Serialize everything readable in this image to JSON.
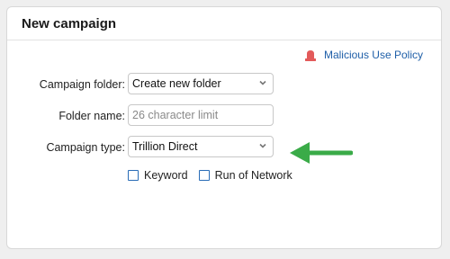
{
  "panel": {
    "title": "New campaign"
  },
  "policy": {
    "label": "Malicious Use Policy",
    "icon": "alarm-icon",
    "icon_color": "#e35a5a",
    "link_color": "#1f5fa8"
  },
  "fields": {
    "folder": {
      "label": "Campaign folder:",
      "value": "Create new folder"
    },
    "folder_name": {
      "label": "Folder name:",
      "placeholder": "26 character limit",
      "value": ""
    },
    "type": {
      "label": "Campaign type:",
      "value": "Trillion Direct"
    }
  },
  "checkboxes": [
    {
      "label": "Keyword",
      "checked": false
    },
    {
      "label": "Run of Network",
      "checked": false
    }
  ],
  "annotation": {
    "icon": "green-arrow-icon",
    "color": "#3aab48"
  }
}
